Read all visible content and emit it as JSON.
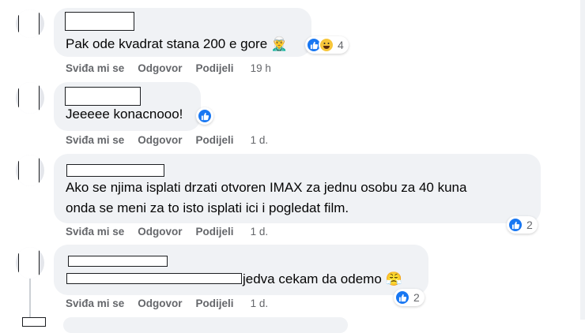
{
  "comments": [
    {
      "text": "Pak ode kvadrat stana 200 e gore",
      "emoji": "🧝‍♂️",
      "actions": {
        "like": "Sviđa mi se",
        "reply": "Odgovor",
        "share": "Podijeli",
        "time": "19 h"
      },
      "reactions": {
        "icons": [
          "like-icon",
          "haha-icon"
        ],
        "count": "4"
      }
    },
    {
      "text": "Jeeeee konacnooo!",
      "actions": {
        "like": "Sviđa mi se",
        "reply": "Odgovor",
        "share": "Podijeli",
        "time": "1 d."
      },
      "reactions": {
        "icons": [
          "like-icon"
        ],
        "count": ""
      }
    },
    {
      "text_line1": "Ako se njima isplati drzati otvoren IMAX za jednu osobu za 40 kuna",
      "text_line2": "onda se meni za to isto isplati ici i pogledat film.",
      "actions": {
        "like": "Sviđa mi se",
        "reply": "Odgovor",
        "share": "Podijeli",
        "time": "1 d."
      },
      "reactions": {
        "icons": [
          "like-icon"
        ],
        "count": "2"
      }
    },
    {
      "text": "jedva cekam da odemo",
      "emoji": "😤",
      "actions": {
        "like": "Sviđa mi se",
        "reply": "Odgovor",
        "share": "Podijeli",
        "time": "1 d."
      },
      "reactions": {
        "icons": [
          "like-icon"
        ],
        "count": "2"
      }
    }
  ],
  "colors": {
    "like": "#1877f2",
    "bubble": "#f0f2f5",
    "meta": "#65676b"
  }
}
